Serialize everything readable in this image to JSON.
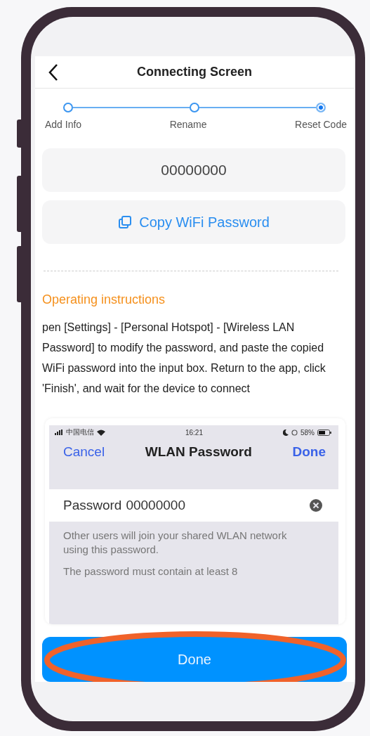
{
  "header": {
    "title": "Connecting Screen"
  },
  "steps": [
    {
      "label": "Add Info",
      "selected": false
    },
    {
      "label": "Rename",
      "selected": false
    },
    {
      "label": "Reset Code",
      "selected": true
    }
  ],
  "code": "00000000",
  "copy_button": {
    "label": "Copy WiFi Password"
  },
  "instructions": {
    "title": "Operating instructions",
    "text": "pen [Settings] - [Personal Hotspot] - [Wireless LAN Password] to modify the password, and paste the copied WiFi password into the input box. Return to the app, click 'Finish', and wait for the device to connect"
  },
  "screenshot": {
    "status_bar": {
      "carrier": "中国电信",
      "time": "16:21",
      "battery": "58%"
    },
    "cancel": "Cancel",
    "title": "WLAN Password",
    "done": "Done",
    "field_label": "Password",
    "field_value": "00000000",
    "note": "Other users will join your shared WLAN network using this password.",
    "note_2": "The password must contain at least 8"
  },
  "done_button": {
    "label": "Done",
    "highlighted": true
  }
}
